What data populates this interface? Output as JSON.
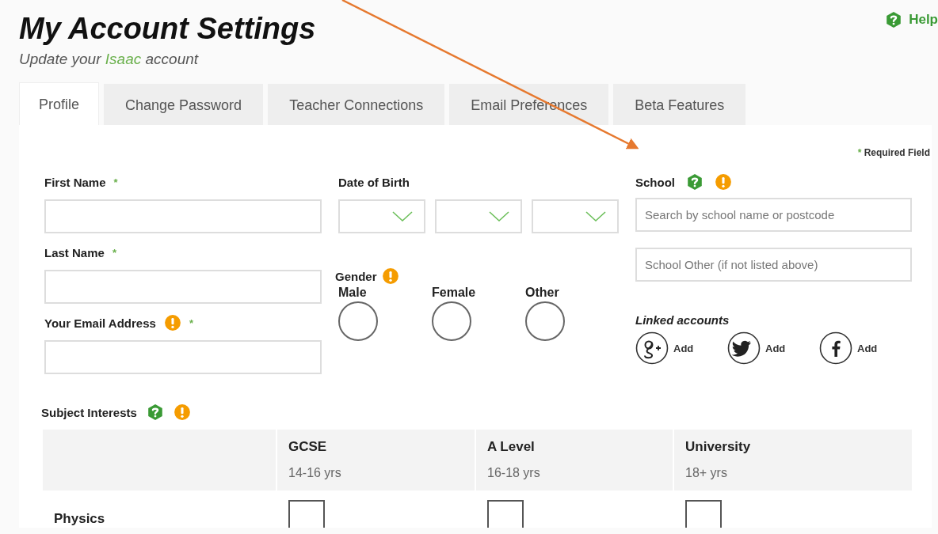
{
  "header": {
    "title": "My Account Settings",
    "subtitle": [
      {
        "text": "Update your ",
        "kind": "plain"
      },
      {
        "text": "Isaac",
        "kind": "brand"
      },
      {
        "text": " account",
        "kind": "plain"
      }
    ]
  },
  "help": {
    "label": "Help"
  },
  "tabs": [
    {
      "label": "Profile",
      "selected": true
    },
    {
      "label": "Change Password",
      "selected": false
    },
    {
      "label": "Teacher Connections",
      "selected": false
    },
    {
      "label": "Email Preferences",
      "selected": false
    },
    {
      "label": "Beta Features",
      "selected": false
    }
  ],
  "required_note": {
    "mark": "*",
    "text": "Required Field"
  },
  "personal_fields": [
    {
      "label": "First Name",
      "required": true,
      "warning": false
    },
    {
      "label": "Last Name",
      "required": true,
      "warning": false
    },
    {
      "label": "Your Email Address",
      "required": true,
      "warning": true
    }
  ],
  "date_of_birth": {
    "label": "Date of Birth",
    "dropdowns": [
      {
        "expanded": false
      },
      {
        "expanded": false
      },
      {
        "expanded": false
      }
    ]
  },
  "gender": {
    "label": "Gender",
    "warning": true,
    "options": [
      {
        "label": "Male",
        "selected": false
      },
      {
        "label": "Female",
        "selected": false
      },
      {
        "label": "Other",
        "selected": false
      }
    ]
  },
  "school": {
    "label": "School",
    "help": true,
    "warning": true,
    "fields": [
      {
        "placeholder": "Search by school name or postcode"
      },
      {
        "placeholder": "School Other (if not listed above)"
      }
    ]
  },
  "linked_accounts": {
    "title": "Linked accounts",
    "items": [
      {
        "kind": "google",
        "action": "Add"
      },
      {
        "kind": "twitter",
        "action": "Add"
      },
      {
        "kind": "facebook",
        "action": "Add"
      }
    ]
  },
  "subject_interests": {
    "label": "Subject Interests",
    "help": true,
    "warning": true,
    "columns": [
      {
        "name": "GCSE",
        "ages": "14-16 yrs"
      },
      {
        "name": "A Level",
        "ages": "16-18 yrs"
      },
      {
        "name": "University",
        "ages": "18+ yrs"
      }
    ],
    "rows": [
      {
        "name": "Physics",
        "checks": [
          {
            "checked": false
          },
          {
            "checked": false
          },
          {
            "checked": false
          }
        ]
      }
    ]
  }
}
